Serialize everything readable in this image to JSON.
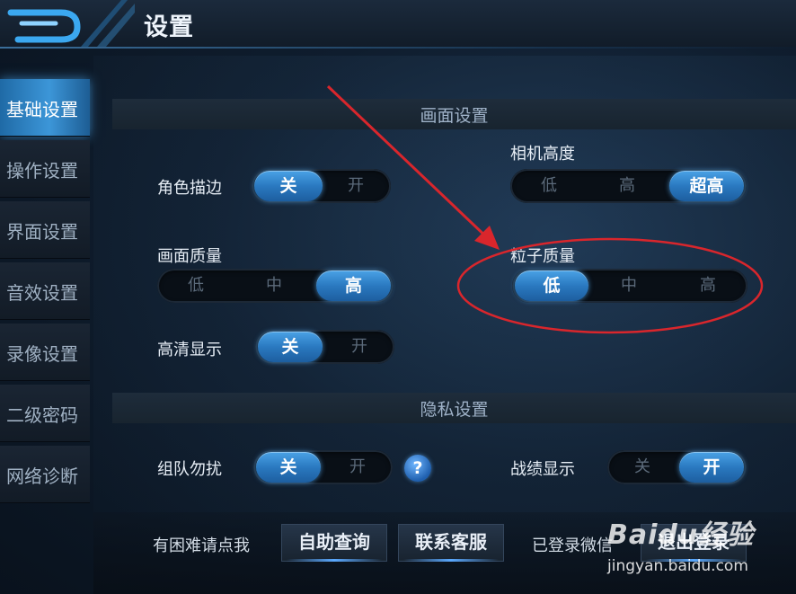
{
  "header": {
    "title": "设置"
  },
  "sidebar": {
    "items": [
      {
        "label": "基础设置",
        "active": true
      },
      {
        "label": "操作设置"
      },
      {
        "label": "界面设置"
      },
      {
        "label": "音效设置"
      },
      {
        "label": "录像设置"
      },
      {
        "label": "二级密码"
      },
      {
        "label": "网络诊断"
      }
    ]
  },
  "graphics": {
    "section_title": "画面设置",
    "outline": {
      "label": "角色描边",
      "options": [
        "关",
        "开"
      ],
      "selected": "关"
    },
    "camera_height": {
      "label": "相机高度",
      "options": [
        "低",
        "高",
        "超高"
      ],
      "selected": "超高"
    },
    "quality": {
      "label": "画面质量",
      "options": [
        "低",
        "中",
        "高"
      ],
      "selected": "高"
    },
    "particle": {
      "label": "粒子质量",
      "options": [
        "低",
        "中",
        "高"
      ],
      "selected": "低"
    },
    "hd": {
      "label": "高清显示",
      "options": [
        "关",
        "开"
      ],
      "selected": "关"
    }
  },
  "privacy": {
    "section_title": "隐私设置",
    "team_dnd": {
      "label": "组队勿扰",
      "options": [
        "关",
        "开"
      ],
      "selected": "关"
    },
    "help_icon": "?",
    "record_display": {
      "label": "战绩显示",
      "options": [
        "关",
        "开"
      ],
      "selected": "开"
    }
  },
  "footer": {
    "help_text": "有困难请点我",
    "self_help_button": "自助查询",
    "contact_button": "联系客服",
    "login_status": "已登录微信",
    "logout_button": "退出登录"
  },
  "watermark": {
    "logo": "Baidu经验",
    "url": "jingyan.baidu.com"
  },
  "colors": {
    "accent": "#2a79c0",
    "annotation": "#d9262c",
    "background": "#0f1d2e"
  }
}
